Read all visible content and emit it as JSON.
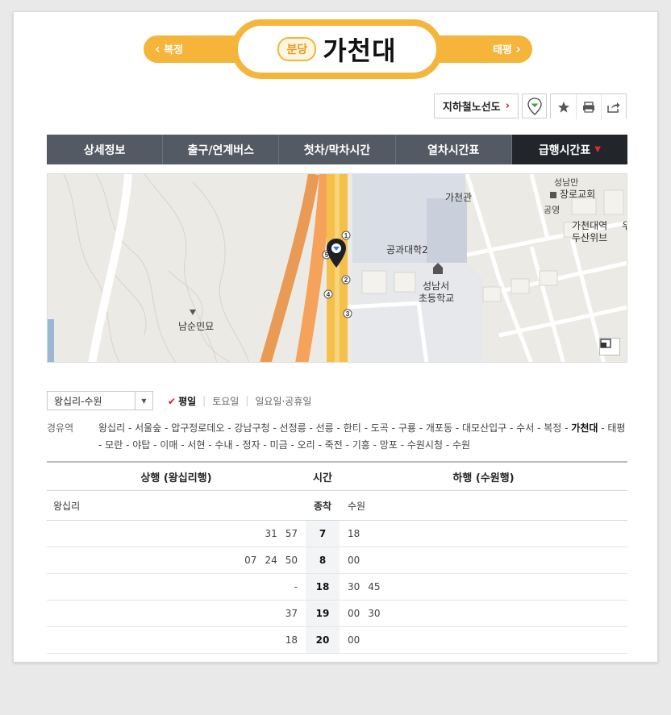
{
  "station_nav": {
    "prev_station": "복정",
    "next_station": "태평",
    "line_badge": "분당",
    "station_name": "가천대"
  },
  "toolbar": {
    "route_map_label": "지하철노선도",
    "icons": [
      "map-pin-icon",
      "star-icon",
      "print-icon",
      "share-icon"
    ]
  },
  "tabs": [
    {
      "label": "상세정보",
      "active": false
    },
    {
      "label": "출구/연계버스",
      "active": false
    },
    {
      "label": "첫차/막차시간",
      "active": false
    },
    {
      "label": "열차시간표",
      "active": false
    },
    {
      "label": "급행시간표",
      "active": true
    }
  ],
  "map": {
    "labels": {
      "church": "장로교회",
      "church_top": "성남만",
      "hall": "가천관",
      "park": "공영",
      "plaza": "가천대역",
      "plaza2": "두산위브",
      "college": "공과대학2",
      "school1": "성남서",
      "school2": "초등학교",
      "tomb": "남순민묘",
      "edge": "우"
    },
    "exit_numbers": [
      "1",
      "2",
      "3",
      "4",
      "5"
    ],
    "colors": {
      "highway": "#f5a25a",
      "rail": "#f5c04a",
      "building": "#d9dde6"
    }
  },
  "filter": {
    "direction_value": "왕십리-수원",
    "day_options": [
      {
        "label": "평일",
        "active": true
      },
      {
        "label": "토요일",
        "active": false
      },
      {
        "label": "일요일·공휴일",
        "active": false
      }
    ]
  },
  "via": {
    "label": "경유역",
    "stations": [
      "왕십리",
      "서울숲",
      "압구정로데오",
      "강남구청",
      "선정릉",
      "선릉",
      "한티",
      "도곡",
      "구룡",
      "개포동",
      "대모산입구",
      "수서",
      "복정",
      "가천대",
      "태평",
      "모란",
      "야탑",
      "이매",
      "서현",
      "수내",
      "정자",
      "미금",
      "오리",
      "죽전",
      "기흥",
      "망포",
      "수원시청",
      "수원"
    ],
    "current": "가천대"
  },
  "timetable": {
    "headers": {
      "up": "상행 (왕십리행)",
      "hour": "시간",
      "down": "하행 (수원행)"
    },
    "subheader": {
      "up": "왕십리",
      "hour": "종착",
      "down": "수원"
    },
    "rows": [
      {
        "hour": "7",
        "up": [
          "31",
          "57"
        ],
        "down": [
          "18"
        ]
      },
      {
        "hour": "8",
        "up": [
          "07",
          "24",
          "50"
        ],
        "down": [
          "00"
        ]
      },
      {
        "hour": "18",
        "up": [
          "-"
        ],
        "down": [
          "30",
          "45"
        ]
      },
      {
        "hour": "19",
        "up": [
          "37"
        ],
        "down": [
          "00",
          "30"
        ]
      },
      {
        "hour": "20",
        "up": [
          "18"
        ],
        "down": [
          "00"
        ]
      }
    ]
  }
}
